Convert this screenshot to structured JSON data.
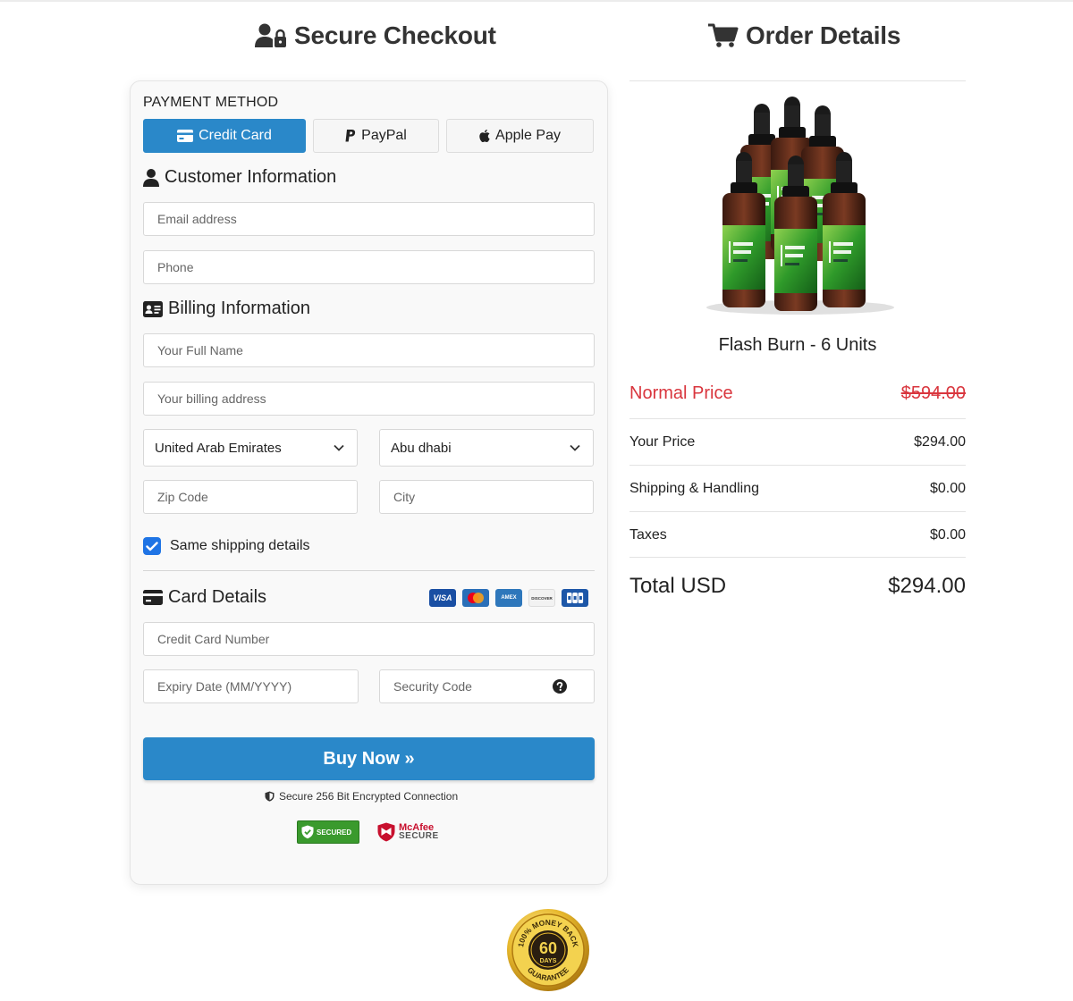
{
  "checkout": {
    "title": "Secure Checkout",
    "payment_method_label": "PAYMENT METHOD",
    "payment_methods": [
      {
        "label": "Credit Card",
        "icon": "credit-card-icon",
        "active": true
      },
      {
        "label": "PayPal",
        "icon": "paypal-icon",
        "active": false
      },
      {
        "label": "Apple Pay",
        "icon": "apple-icon",
        "active": false
      }
    ],
    "customer_heading": "Customer Information",
    "email_placeholder": "Email address",
    "phone_placeholder": "Phone",
    "billing_heading": "Billing Information",
    "fullname_placeholder": "Your Full Name",
    "address_placeholder": "Your billing address",
    "country_selected": "United Arab Emirates",
    "region_selected": "Abu dhabi",
    "zip_placeholder": "Zip Code",
    "city_placeholder": "City",
    "same_shipping_label": "Same shipping details",
    "same_shipping_checked": true,
    "card_heading": "Card Details",
    "card_brands": [
      "VISA",
      "mastercard",
      "AMEX",
      "DISCOVER",
      "JCB"
    ],
    "card_number_placeholder": "Credit Card Number",
    "expiry_placeholder": "Expiry Date (MM/YYYY)",
    "security_placeholder": "Security Code",
    "buy_label": "Buy Now »",
    "secure_connection": "Secure 256 Bit Encrypted Connection",
    "badge_secured": "SECURED",
    "badge_mcafee_top": "McAfee",
    "badge_mcafee_bottom": "SECURE"
  },
  "order": {
    "title": "Order Details",
    "product_name": "Flash Burn - 6 Units",
    "product_label": "Flash Burn",
    "normal_price_label": "Normal Price",
    "normal_price": "$594.00",
    "your_price_label": "Your Price",
    "your_price": "$294.00",
    "shipping_label": "Shipping & Handling",
    "shipping": "$0.00",
    "taxes_label": "Taxes",
    "taxes": "$0.00",
    "total_label": "Total USD",
    "total": "$294.00"
  },
  "guarantee": {
    "number": "60",
    "days": "DAYS",
    "ring_top": "100% MONEY BACK",
    "ring_bottom": "GUARANTEE"
  },
  "colors": {
    "accent": "#2a88c9",
    "normal_price": "#d9363e",
    "checkbox": "#1f74e5"
  }
}
